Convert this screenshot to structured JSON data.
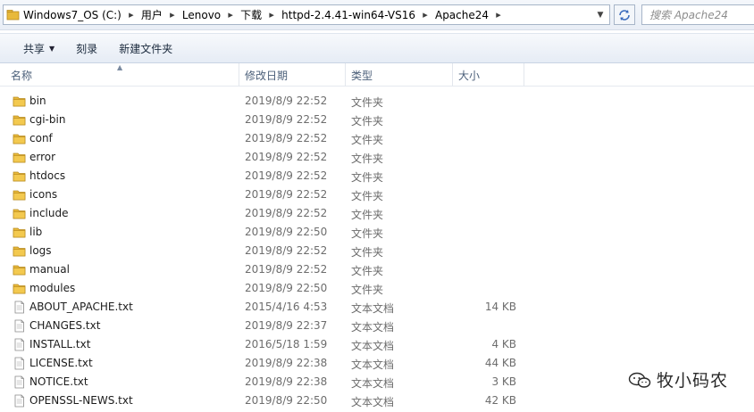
{
  "address": {
    "crumbs": [
      "Windows7_OS (C:)",
      "用户",
      "Lenovo",
      "下载",
      "httpd-2.4.41-win64-VS16",
      "Apache24"
    ],
    "search_placeholder": "搜索 Apache24"
  },
  "toolbar": {
    "share_label": "共享",
    "burn_label": "刻录",
    "new_folder_label": "新建文件夹"
  },
  "columns": {
    "name": "名称",
    "date": "修改日期",
    "type": "类型",
    "size": "大小"
  },
  "files": [
    {
      "name": "bin",
      "date": "2019/8/9 22:52",
      "type": "文件夹",
      "size": "",
      "icon": "folder-icon"
    },
    {
      "name": "cgi-bin",
      "date": "2019/8/9 22:52",
      "type": "文件夹",
      "size": "",
      "icon": "folder-icon"
    },
    {
      "name": "conf",
      "date": "2019/8/9 22:52",
      "type": "文件夹",
      "size": "",
      "icon": "folder-icon"
    },
    {
      "name": "error",
      "date": "2019/8/9 22:52",
      "type": "文件夹",
      "size": "",
      "icon": "folder-icon"
    },
    {
      "name": "htdocs",
      "date": "2019/8/9 22:52",
      "type": "文件夹",
      "size": "",
      "icon": "folder-icon"
    },
    {
      "name": "icons",
      "date": "2019/8/9 22:52",
      "type": "文件夹",
      "size": "",
      "icon": "folder-icon"
    },
    {
      "name": "include",
      "date": "2019/8/9 22:52",
      "type": "文件夹",
      "size": "",
      "icon": "folder-icon"
    },
    {
      "name": "lib",
      "date": "2019/8/9 22:50",
      "type": "文件夹",
      "size": "",
      "icon": "folder-icon"
    },
    {
      "name": "logs",
      "date": "2019/8/9 22:52",
      "type": "文件夹",
      "size": "",
      "icon": "folder-icon"
    },
    {
      "name": "manual",
      "date": "2019/8/9 22:52",
      "type": "文件夹",
      "size": "",
      "icon": "folder-icon"
    },
    {
      "name": "modules",
      "date": "2019/8/9 22:50",
      "type": "文件夹",
      "size": "",
      "icon": "folder-icon"
    },
    {
      "name": "ABOUT_APACHE.txt",
      "date": "2015/4/16 4:53",
      "type": "文本文档",
      "size": "14 KB",
      "icon": "text-file-icon"
    },
    {
      "name": "CHANGES.txt",
      "date": "2019/8/9 22:37",
      "type": "文本文档",
      "size": "",
      "icon": "text-file-icon"
    },
    {
      "name": "INSTALL.txt",
      "date": "2016/5/18 1:59",
      "type": "文本文档",
      "size": "4 KB",
      "icon": "text-file-icon"
    },
    {
      "name": "LICENSE.txt",
      "date": "2019/8/9 22:38",
      "type": "文本文档",
      "size": "44 KB",
      "icon": "text-file-icon"
    },
    {
      "name": "NOTICE.txt",
      "date": "2019/8/9 22:38",
      "type": "文本文档",
      "size": "3 KB",
      "icon": "text-file-icon"
    },
    {
      "name": "OPENSSL-NEWS.txt",
      "date": "2019/8/9 22:50",
      "type": "文本文档",
      "size": "42 KB",
      "icon": "text-file-icon"
    }
  ],
  "watermark": {
    "text": "牧小码农",
    "icon": "wechat-icon"
  },
  "colors": {
    "folder": "#e8b93b",
    "header_text": "#4c607a",
    "meta_text": "#6d6d6d"
  }
}
